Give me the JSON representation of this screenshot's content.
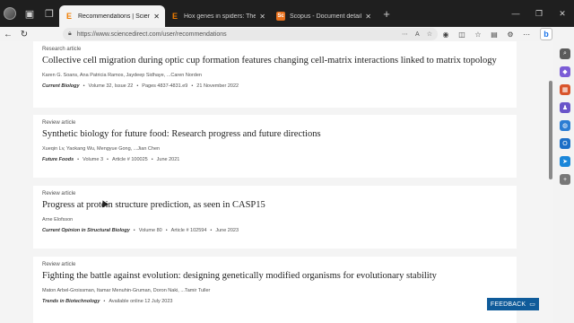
{
  "tabs": [
    {
      "title": "Recommendations | ScienceDirect",
      "icon": "elsevier-icon",
      "active": true
    },
    {
      "title": "Hox genes in spiders: Their significance",
      "icon": "elsevier-icon",
      "active": false
    },
    {
      "title": "Scopus - Document details - Gen",
      "icon": "scopus-icon",
      "active": false
    }
  ],
  "address": {
    "url": "https://www.sciencedirect.com/user/recommendations"
  },
  "articles": [
    {
      "kind": "Research article",
      "title": "Collective cell migration during optic cup formation features changing cell-matrix interactions linked to matrix topology",
      "authors": "Karen G. Soans, Ana Patricia Ramos, Jaydeep Sidhaye, ...Caren Norden",
      "journal": "Current Biology",
      "details": [
        "Volume 32, Issue 22",
        "Pages 4837-4831.e9",
        "21 November 2022"
      ]
    },
    {
      "kind": "Review article",
      "title": "Synthetic biology for future food: Research progress and future directions",
      "authors": "Xueqin Lv, Yaokang Wu, Mengyue Gong, ...Jian Chen",
      "journal": "Future Foods",
      "details": [
        "Volume 3",
        "Article # 100025",
        "June 2021"
      ]
    },
    {
      "kind": "Review article",
      "title": "Progress at protein structure prediction, as seen in CASP15",
      "authors": "Arne Elofsson",
      "journal": "Current Opinion in Structural Biology",
      "details": [
        "Volume 80",
        "Article # 102594",
        "June 2023"
      ]
    },
    {
      "kind": "Review article",
      "title": "Fighting the battle against evolution: designing genetically modified organisms for evolutionary stability",
      "authors": "Maton Arbel-Groissman, Itamar Menuhin-Gruman, Doron Naki, ...Tamir Tuller",
      "journal": "Trends in Biotechnology",
      "details": [
        "Available online 12 July 2023"
      ]
    }
  ],
  "feedback": {
    "label": "FEEDBACK"
  },
  "colors": {
    "feedback": "#0f5b9a",
    "tab_bar": "#1f1f1f"
  }
}
